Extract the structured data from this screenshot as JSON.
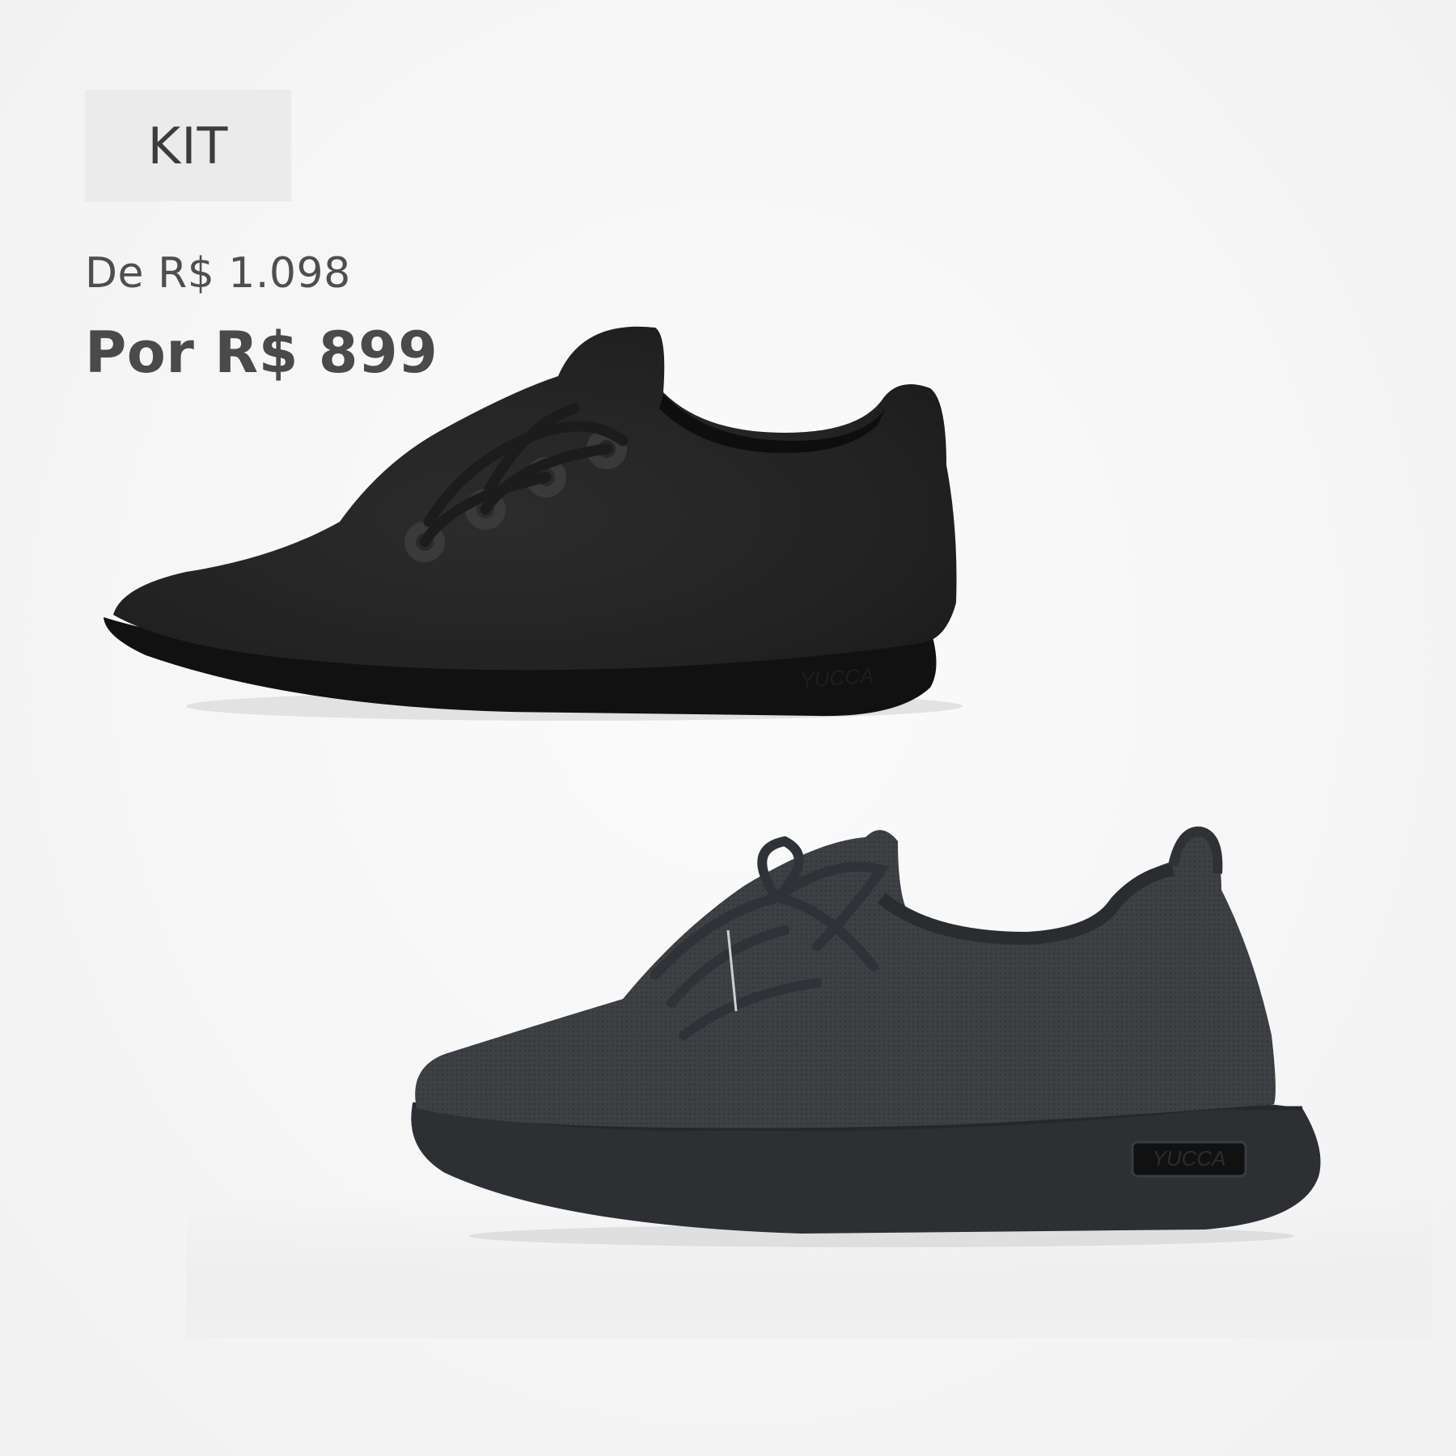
{
  "badge": {
    "label": "KIT"
  },
  "pricing": {
    "old_price": "De R$ 1.098",
    "new_price": "Por R$ 899"
  },
  "products": [
    {
      "image": "black-wool-sneaker",
      "logo_text": "YUCCA"
    },
    {
      "image": "dark-grey-knit-sneaker",
      "logo_text": "YUCCA"
    }
  ],
  "colors": {
    "background": "#f6f6f6",
    "badge_bg": "#ebebeb",
    "text": "#4a4a4a",
    "wool_upper": "#232323",
    "knit_upper": "#3d3f43",
    "sole": "#161616"
  }
}
